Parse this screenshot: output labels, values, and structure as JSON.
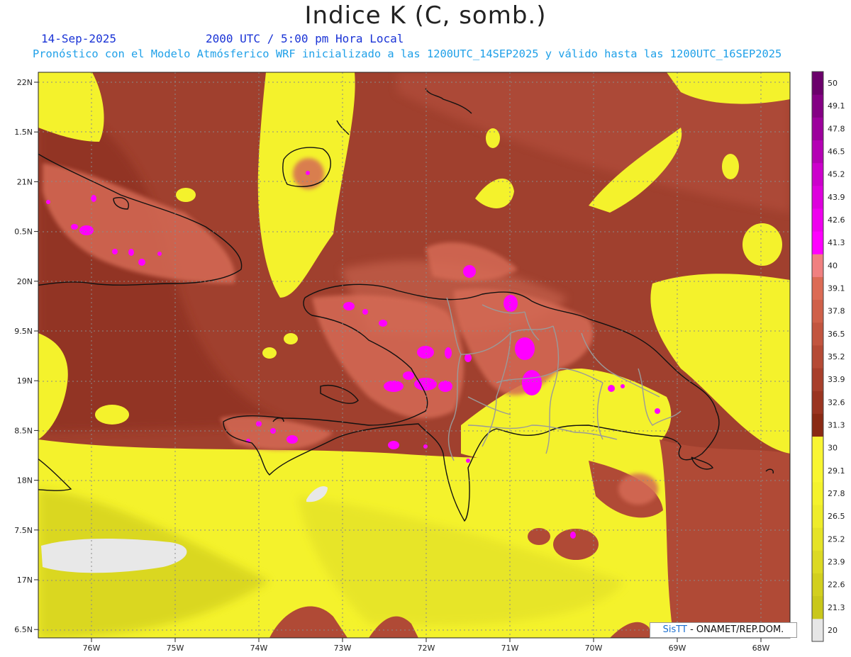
{
  "header": {
    "title": "Indice K (C, somb.)",
    "date": "14-Sep-2025",
    "time": "2000 UTC / 5:00 pm Hora Local",
    "subtitle": "Pronóstico con el Modelo Atmósferico WRF inicializado a las 1200UTC_14SEP2025 y válido hasta las  1200UTC_16SEP2025"
  },
  "map": {
    "lon_range": [
      -76.65,
      -67.6
    ],
    "lat_range": [
      16.35,
      22.15
    ],
    "lat_ticks": [
      "22N",
      "1.5N",
      "21N",
      "0.5N",
      "20N",
      "9.5N",
      "19N",
      "8.5N",
      "18N",
      "7.5N",
      "17N",
      "6.5N"
    ],
    "lon_ticks": [
      "76W",
      "75W",
      "74W",
      "73W",
      "72W",
      "71W",
      "70W",
      "69W",
      "68W"
    ]
  },
  "legend": {
    "levels": [
      "20",
      "21.3",
      "22.6",
      "23.9",
      "25.2",
      "26.5",
      "27.8",
      "29.1",
      "30",
      "31.3",
      "32.6",
      "33.9",
      "35.2",
      "36.5",
      "37.8",
      "39.1",
      "40",
      "41.3",
      "42.6",
      "43.9",
      "45.2",
      "46.5",
      "47.8",
      "49.1",
      "50"
    ],
    "colors": [
      "#e6e6e6",
      "#c9c71a",
      "#d2cf1e",
      "#dcd923",
      "#e5e327",
      "#eeec2a",
      "#f4f22c",
      "#f8f630",
      "#f9f533",
      "#8a2a14",
      "#9a3420",
      "#a83f2b",
      "#b54a35",
      "#c2553f",
      "#cf6049",
      "#dc6b55",
      "#f08080",
      "#ff00ff",
      "#ee00ee",
      "#dd00dd",
      "#cc00cc",
      "#b400b4",
      "#9c009c",
      "#840084",
      "#6b006b"
    ]
  },
  "credit": {
    "brand": "SisTT",
    "text": " - ONAMET/REP.DOM."
  },
  "colors": {
    "ocean_hot": "#a0402e",
    "land_hot": "#c2553f",
    "yellow_zone": "#f4f22c",
    "magenta": "#ff00ff",
    "grey_zone": "#e8e8e8"
  }
}
